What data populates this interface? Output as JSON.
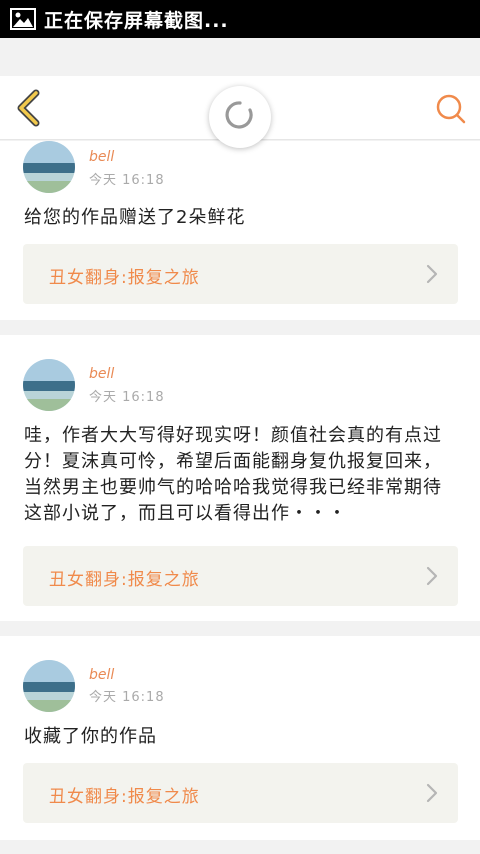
{
  "status_bar": {
    "text": "正在保存屏幕截图..."
  },
  "header": {},
  "feed": [
    {
      "username": "bell",
      "time": "今天  16:18",
      "message": "给您的作品赠送了2朵鲜花",
      "work_title": "丑女翻身:报复之旅"
    },
    {
      "username": "bell",
      "time": "今天  16:18",
      "message": "哇，作者大大写得好现实呀！颜值社会真的有点过分！夏沫真可怜，希望后面能翻身复仇报复回来，当然男主也要帅气的哈哈哈我觉得我已经非常期待这部小说了，而且可以看得出作・・・",
      "work_title": "丑女翻身:报复之旅"
    },
    {
      "username": "bell",
      "time": "今天  16:18",
      "message": "收藏了你的作品",
      "work_title": "丑女翻身:报复之旅"
    }
  ],
  "colors": {
    "accent": "#f08a4b",
    "back_arrow": "#f2c94c",
    "background": "#f2f2f2"
  },
  "icons": {
    "status": "image-icon",
    "back": "back-arrow-icon",
    "search": "search-icon",
    "refresh": "refresh-icon",
    "chevron": "chevron-right-icon"
  }
}
